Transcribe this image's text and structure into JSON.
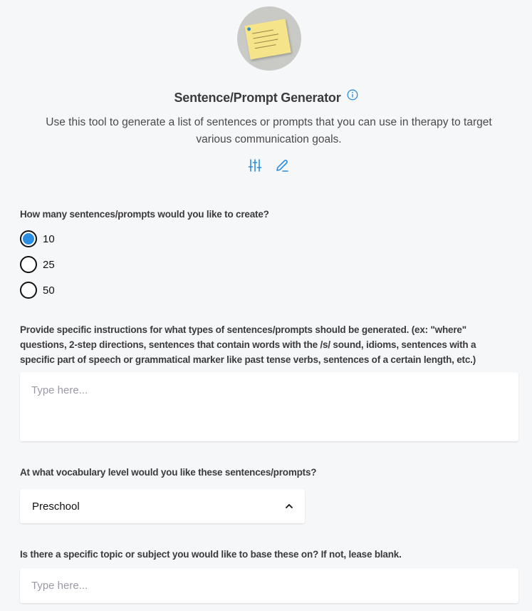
{
  "header": {
    "avatar_alt": "sticky-note-image",
    "title": "Sentence/Prompt Generator",
    "description": "Use this tool to generate a list of sentences or prompts that you can use in therapy to target various communication goals.",
    "icons": {
      "info": "info-icon",
      "settings": "sliders-icon",
      "edit": "pencil-icon"
    }
  },
  "form": {
    "count": {
      "label": "How many sentences/prompts would you like to create?",
      "options": [
        "10",
        "25",
        "50"
      ],
      "selected": "10"
    },
    "instructions": {
      "label": "Provide specific instructions for what types of sentences/prompts should be generated. (ex: \"where\" questions, 2-step directions, sentences that contain words with the /s/ sound, idioms, sentences with a specific part of speech or grammatical marker like past tense verbs, sentences of a certain length, etc.)",
      "placeholder": "Type here...",
      "value": ""
    },
    "vocabulary": {
      "label": "At what vocabulary level would you like these sentences/prompts?",
      "selected": "Preschool"
    },
    "topic": {
      "label": "Is there a specific topic or subject you would like to base these on? If not, lease blank.",
      "placeholder": "Type here...",
      "value": ""
    }
  },
  "colors": {
    "accent": "#2b8ee0",
    "background": "#f6f7f9",
    "text": "#3b3b3f",
    "placeholder": "#9a9aa6"
  }
}
